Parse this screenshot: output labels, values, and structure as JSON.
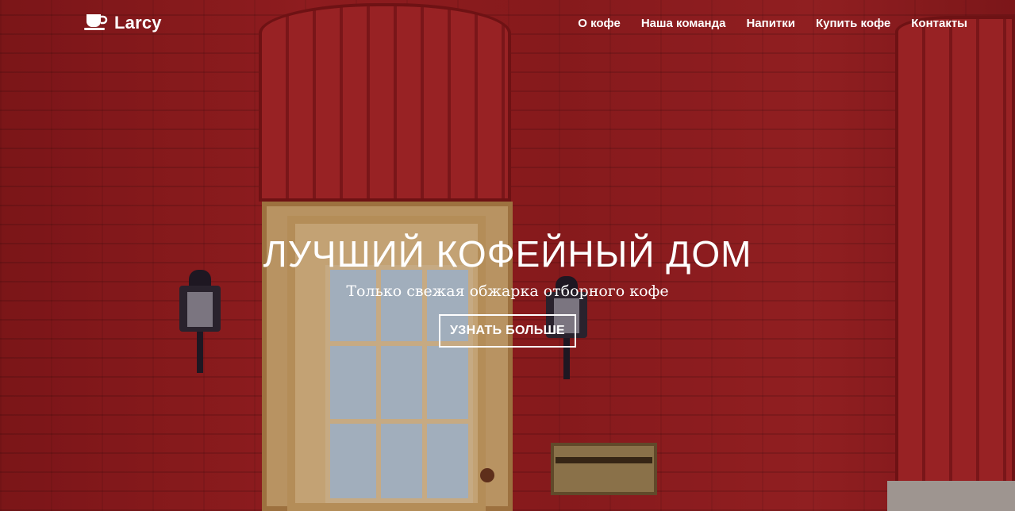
{
  "brand": {
    "name": "Larcy",
    "icon": "coffee-cup-icon"
  },
  "nav": {
    "items": [
      {
        "label": "О кофе"
      },
      {
        "label": "Наша команда"
      },
      {
        "label": "Напитки"
      },
      {
        "label": "Купить кофе"
      },
      {
        "label": "Контакты"
      }
    ]
  },
  "hero": {
    "title": "ЛУЧШИЙ КОФЕЙНЫЙ ДОМ",
    "subtitle": "Только свежая обжарка отборного кофе",
    "button_label": "УЗНАТЬ БОЛЬШЕ"
  },
  "colors": {
    "background_red": "#9a1f22",
    "text": "#ffffff"
  }
}
